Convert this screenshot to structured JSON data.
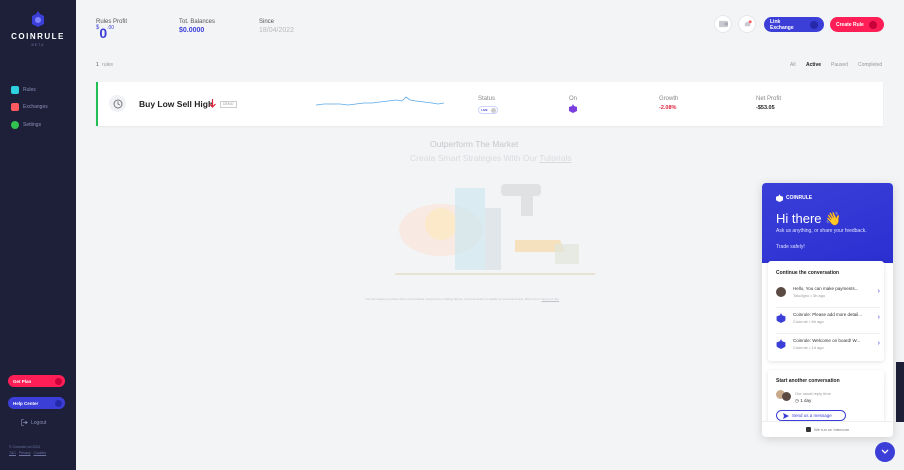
{
  "sidebar": {
    "brand": "COINRULE",
    "brand_sub": "BETA",
    "nav": [
      {
        "label": "Rules",
        "icon": "rules-icon",
        "color": "#2fd0e0"
      },
      {
        "label": "Exchanges",
        "icon": "exchanges-icon",
        "color": "#ff5a5f"
      },
      {
        "label": "Settings",
        "icon": "gear-icon",
        "color": "#31c24f"
      }
    ],
    "get_plan": "Get Plan",
    "help_center": "Help Center",
    "logout": "Logout",
    "copyright": "© Coinrule Ltd 2020",
    "links": [
      "T&C",
      "Privacy",
      "Cookies"
    ]
  },
  "header": {
    "rules_profit_label": "Rules Profit",
    "rules_profit_currency": "$",
    "rules_profit_value": "0",
    "rules_profit_decimals": ".00",
    "balances_label": "Tot. Balances",
    "balances_value": "$0.0000",
    "since_label": "Since",
    "since_value": "18/04/2022",
    "link_exchange": "Link Exchange",
    "create_rule": "Create Rule"
  },
  "rules": {
    "count": "1",
    "count_label": "rules",
    "filters": [
      "All",
      "Active",
      "Paused",
      "Completed"
    ],
    "active_filter": "Active",
    "items": [
      {
        "name": "Buy Low Sell High",
        "tag": "DEMO",
        "status_label": "Status",
        "status_value": "LIVE",
        "on_label": "On",
        "growth_label": "Growth",
        "growth_value": "-2.08%",
        "net_profit_label": "Net Profit",
        "net_profit_value": "-$53.05"
      }
    ]
  },
  "promo": {
    "title": "Outperform The Market",
    "subtitle_prefix": "Create Smart Strategies With Our ",
    "subtitle_link": "Tutorials",
    "disclaimer": "The information provided does not constitute investment or trading advice. Coinrule bears no liability for financial losses. More info in",
    "disclaimer_link": "Terms of Use"
  },
  "chat": {
    "brand": "COINRULE",
    "greeting": "Hi there 👋",
    "ask": "Ask us anything, or share your feedback.",
    "safe": "Trade safely!",
    "continue_title": "Continue the conversation",
    "conversations": [
      {
        "msg": "Hello, You can make payments...",
        "meta": "Tolu/Igno • 3h ago",
        "avatar": "person"
      },
      {
        "msg": "Coinrule: Please add more detail...",
        "meta": "Coinrule • 6h ago",
        "avatar": "bot"
      },
      {
        "msg": "Coinrule: Welcome on board! W...",
        "meta": "Coinrule • 1d ago",
        "avatar": "bot"
      }
    ],
    "start_title": "Start another conversation",
    "reply_time_label": "Our usual reply time",
    "reply_time": "1 day",
    "send_label": "Send us a message",
    "footer": "We run on Intercom"
  },
  "colors": {
    "accent": "#3b3fd8",
    "danger": "#ff1e56",
    "success": "#1fbf56",
    "sidebar_bg": "#1d2038"
  }
}
